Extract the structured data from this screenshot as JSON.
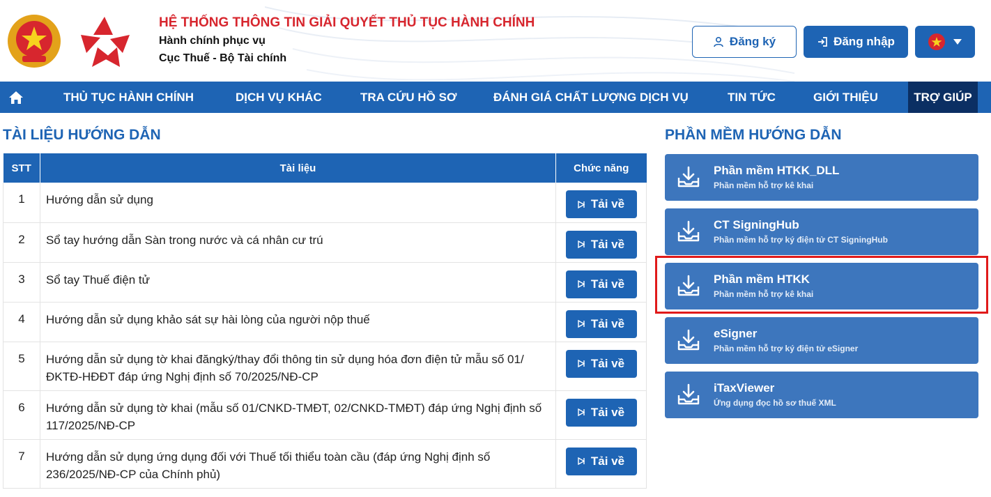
{
  "header": {
    "title": "HỆ THỐNG THÔNG TIN GIẢI QUYẾT THỦ TỤC HÀNH CHÍNH",
    "subtitle": "Hành chính phục vụ",
    "org": "Cục Thuế - Bộ Tài chính",
    "register_label": "Đăng ký",
    "login_label": "Đăng nhập",
    "language_icon": "vietnam-flag-icon"
  },
  "colors": {
    "primary": "#1e64b4",
    "nav_active": "#0b2f63",
    "title_red": "#d7262e",
    "card": "#3d76bd",
    "highlight": "#e01a1a"
  },
  "nav": {
    "items": [
      {
        "label": "THỦ TỤC HÀNH CHÍNH"
      },
      {
        "label": "DỊCH VỤ KHÁC"
      },
      {
        "label": "TRA CỨU HỒ SƠ"
      },
      {
        "label": "ĐÁNH GIÁ CHẤT LƯỢNG DỊCH VỤ"
      },
      {
        "label": "TIN TỨC"
      },
      {
        "label": "GIỚI THIỆU"
      },
      {
        "label": "TRỢ GIÚP"
      }
    ]
  },
  "docs": {
    "title": "TÀI LIỆU HƯỚNG DẪN",
    "headers": [
      "STT",
      "Tài liệu",
      "Chức năng"
    ],
    "download_label": "Tải về",
    "rows": [
      {
        "stt": "1",
        "name": "Hướng dẫn sử dụng"
      },
      {
        "stt": "2",
        "name": "Sổ tay hướng dẫn Sàn trong nước và cá nhân cư trú"
      },
      {
        "stt": "3",
        "name": "Sổ tay Thuế điện tử"
      },
      {
        "stt": "4",
        "name": "Hướng dẫn sử dụng khảo sát sự hài lòng của người nộp thuế"
      },
      {
        "stt": "5",
        "name": "Hướng dẫn sử dụng tờ khai đăngký/thay đổi thông tin sử dụng hóa đơn điện tử mẫu số 01/ĐKTĐ-HĐĐT đáp ứng Nghị định số 70/2025/NĐ-CP"
      },
      {
        "stt": "6",
        "name": "Hướng dẫn sử dụng tờ khai (mẫu số 01/CNKD-TMĐT, 02/CNKD-TMĐT) đáp ứng Nghị định số 117/2025/NĐ-CP"
      },
      {
        "stt": "7",
        "name": "Hướng dẫn sử dụng ứng dụng đối với Thuế tối thiểu toàn cầu (đáp ứng Nghị định số 236/2025/NĐ-CP của Chính phủ)"
      }
    ]
  },
  "software": {
    "title": "PHẦN MỀM HƯỚNG DẪN",
    "items": [
      {
        "title": "Phần mềm HTKK_DLL",
        "desc": "Phần mềm hỗ trợ kê khai"
      },
      {
        "title": "CT SigningHub",
        "desc": "Phần mềm hỗ trợ ký điện tử CT SigningHub"
      },
      {
        "title": "Phần mềm HTKK",
        "desc": "Phần mềm hỗ trợ kê khai"
      },
      {
        "title": "eSigner",
        "desc": "Phần mềm hỗ trợ ký điện tử eSigner"
      },
      {
        "title": "iTaxViewer",
        "desc": "Ứng dụng đọc hồ sơ thuế XML"
      }
    ]
  }
}
